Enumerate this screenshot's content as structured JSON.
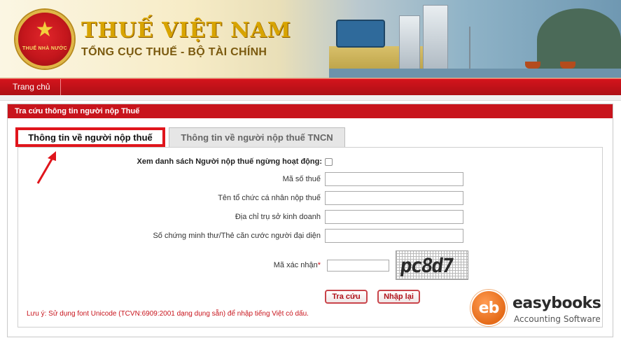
{
  "header": {
    "emblem_text": "THUẾ NHÀ NƯỚC",
    "title": "THUẾ VIỆT NAM",
    "subtitle": "TỔNG CỤC THUẾ - BỘ TÀI CHÍNH"
  },
  "nav": {
    "items": [
      {
        "label": "Trang chủ"
      }
    ]
  },
  "panel": {
    "title": "Tra cứu thông tin người nộp Thuế",
    "tabs": [
      {
        "label": "Thông tin về người nộp thuế",
        "active": true
      },
      {
        "label": "Thông tin về người nộp thuế TNCN",
        "active": false
      }
    ]
  },
  "form": {
    "inactive_list_label": "Xem danh sách Người nộp thuế ngừng hoạt động:",
    "tax_code_label": "Mã số thuế",
    "tax_code_value": "",
    "name_label": "Tên tổ chức cá nhân nộp thuế",
    "name_value": "",
    "address_label": "Địa chỉ trụ sở kinh doanh",
    "address_value": "",
    "id_label": "Số chứng minh thư/Thẻ căn cước người đại diện",
    "id_value": "",
    "captcha_label": "Mã xác nhận",
    "captcha_required_mark": "*",
    "captcha_value": "",
    "captcha_image_text": "pc8d7"
  },
  "buttons": {
    "search": "Tra cứu",
    "reset": "Nhập lại"
  },
  "note": "Lưu ý: Sử dụng font Unicode (TCVN:6909:2001 dạng dụng sẵn) để nhập tiếng Việt có dấu.",
  "watermark": {
    "logo_text": "eb",
    "name": "easybooks",
    "tagline": "Accounting Software"
  },
  "colors": {
    "brand_red": "#c8141c",
    "highlight_red": "#e0151c",
    "gold": "#d8a400"
  }
}
